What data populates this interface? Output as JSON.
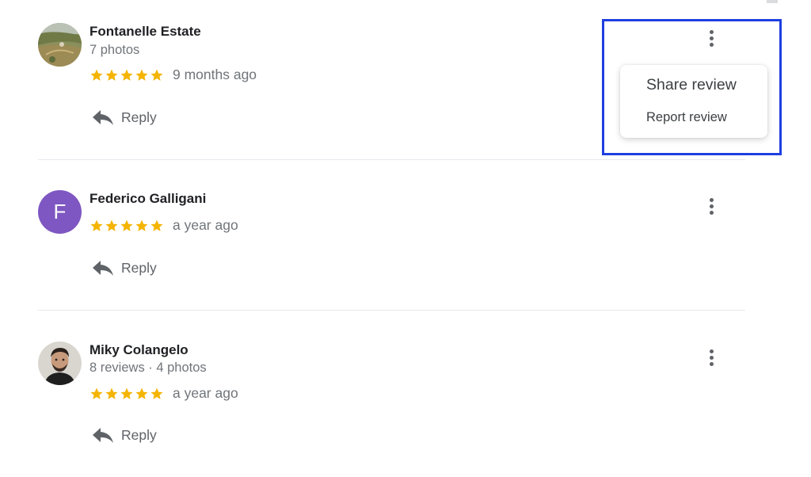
{
  "reviews": [
    {
      "name": "Fontanelle Estate",
      "meta": "7 photos",
      "stars": 5,
      "when": "9 months ago",
      "reply": "Reply",
      "avatar": "landscape-photo"
    },
    {
      "name": "Federico Galligani",
      "meta": "",
      "stars": 5,
      "when": "a year ago",
      "reply": "Reply",
      "avatar_letter": "F"
    },
    {
      "name": "Miky Colangelo",
      "meta": "8 reviews · 4 photos",
      "stars": 5,
      "when": "a year ago",
      "reply": "Reply",
      "avatar": "person-photo"
    }
  ],
  "menu": {
    "share": "Share review",
    "report": "Report review"
  },
  "colors": {
    "star": "#f4b400",
    "highlight": "#1f3fe0",
    "avatar_letter_bg": "#7e57c2"
  },
  "icons": [
    "reply-icon",
    "more-vert-icon",
    "star-icon"
  ]
}
